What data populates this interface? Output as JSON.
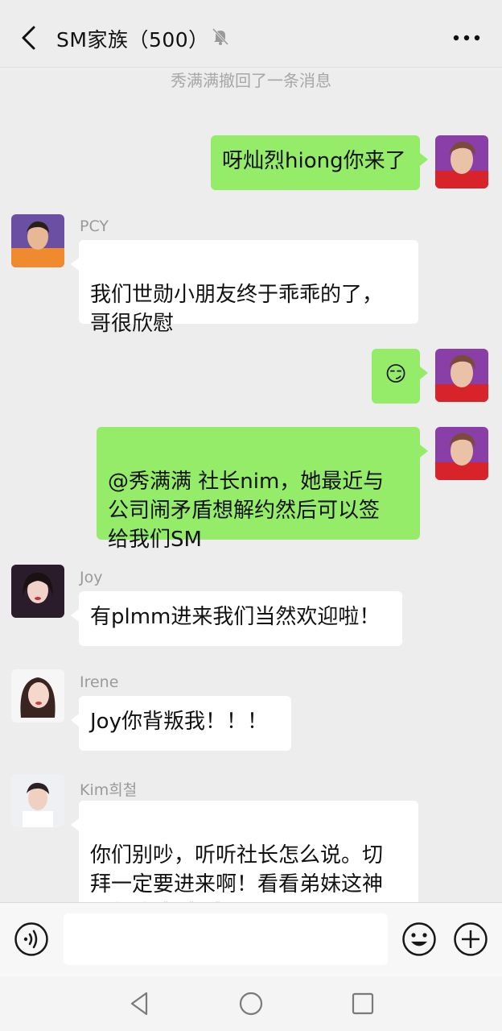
{
  "header": {
    "title": "SM家族（500）",
    "back_icon": "chevron-left-icon",
    "mute_icon": "bell-muted-icon",
    "more_icon": "more-dots-icon"
  },
  "system_notice": "秀满满撤回了一条消息",
  "messages": [
    {
      "side": "right",
      "sender": "",
      "text": "呀灿烈hiong你来了"
    },
    {
      "side": "left",
      "sender": "PCY",
      "text": "我们世勋小朋友终于乖乖的了，\n哥很欣慰"
    },
    {
      "side": "right",
      "sender": "",
      "text": "😏"
    },
    {
      "side": "right",
      "sender": "",
      "text": "@秀满满 社长nim，她最近与\n公司闹矛盾想解约然后可以签\n给我们SM"
    },
    {
      "side": "left",
      "sender": "Joy",
      "text": "有plmm进来我们当然欢迎啦！"
    },
    {
      "side": "left",
      "sender": "Irene",
      "text": "Joy你背叛我！！！"
    },
    {
      "side": "left",
      "sender": "Kim희철",
      "text": "你们别吵，听听社长怎么说。切\n拜一定要进来啊！看看弟妹这神\n仙颜值🙏🙏🙏"
    }
  ],
  "input_bar": {
    "voice_icon": "voice-icon",
    "emoji_icon": "emoji-icon",
    "plus_icon": "plus-icon",
    "text_value": ""
  },
  "nav": {
    "back_icon": "triangle-back-icon",
    "home_icon": "circle-home-icon",
    "recents_icon": "square-recents-icon"
  },
  "colors": {
    "background": "#ededed",
    "self_bubble": "#95ec69",
    "other_bubble": "#ffffff",
    "system_text": "#a7a7a7"
  }
}
